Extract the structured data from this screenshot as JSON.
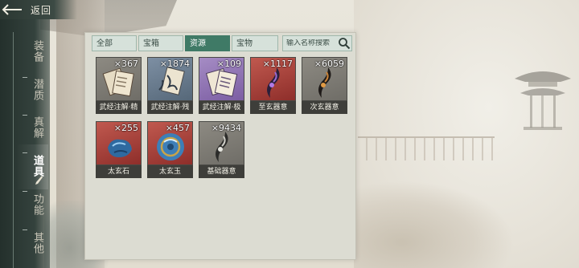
{
  "header": {
    "back_label": "返回"
  },
  "nav": {
    "items": [
      {
        "label": "装备"
      },
      {
        "label": "潜质"
      },
      {
        "label": "真解"
      },
      {
        "label": "道具"
      },
      {
        "label": "功能"
      },
      {
        "label": "其他"
      }
    ],
    "active_index": 3
  },
  "tabs": [
    {
      "label": "全部"
    },
    {
      "label": "宝箱"
    },
    {
      "label": "资源"
    },
    {
      "label": "宝物"
    }
  ],
  "active_tab": "资源",
  "search": {
    "placeholder": "输入名称搜索",
    "value": ""
  },
  "items": [
    {
      "name": "武经注解·精",
      "qty": "×367",
      "quality": "grey",
      "icon": "scroll-icon"
    },
    {
      "name": "武经注解·残",
      "qty": "×1874",
      "quality": "blue",
      "icon": "scroll-icon"
    },
    {
      "name": "武经注解·极",
      "qty": "×109",
      "quality": "purple",
      "icon": "scroll-icon"
    },
    {
      "name": "至玄器意",
      "qty": "×1117",
      "quality": "red",
      "icon": "blade-spirit-icon"
    },
    {
      "name": "次玄器意",
      "qty": "×6059",
      "quality": "grey",
      "icon": "blade-spirit-icon"
    },
    {
      "name": "太玄石",
      "qty": "×255",
      "quality": "red",
      "icon": "stone-icon"
    },
    {
      "name": "太玄玉",
      "qty": "×457",
      "quality": "red",
      "icon": "jade-icon"
    },
    {
      "name": "基础器意",
      "qty": "×9434",
      "quality": "grey",
      "icon": "blade-spirit-icon"
    }
  ],
  "colors": {
    "active_tab": "#3f7a66",
    "quality_grey": "#7d7a73",
    "quality_blue": "#6a7c8f",
    "quality_purple": "#9074b4",
    "quality_red": "#a8423c"
  }
}
